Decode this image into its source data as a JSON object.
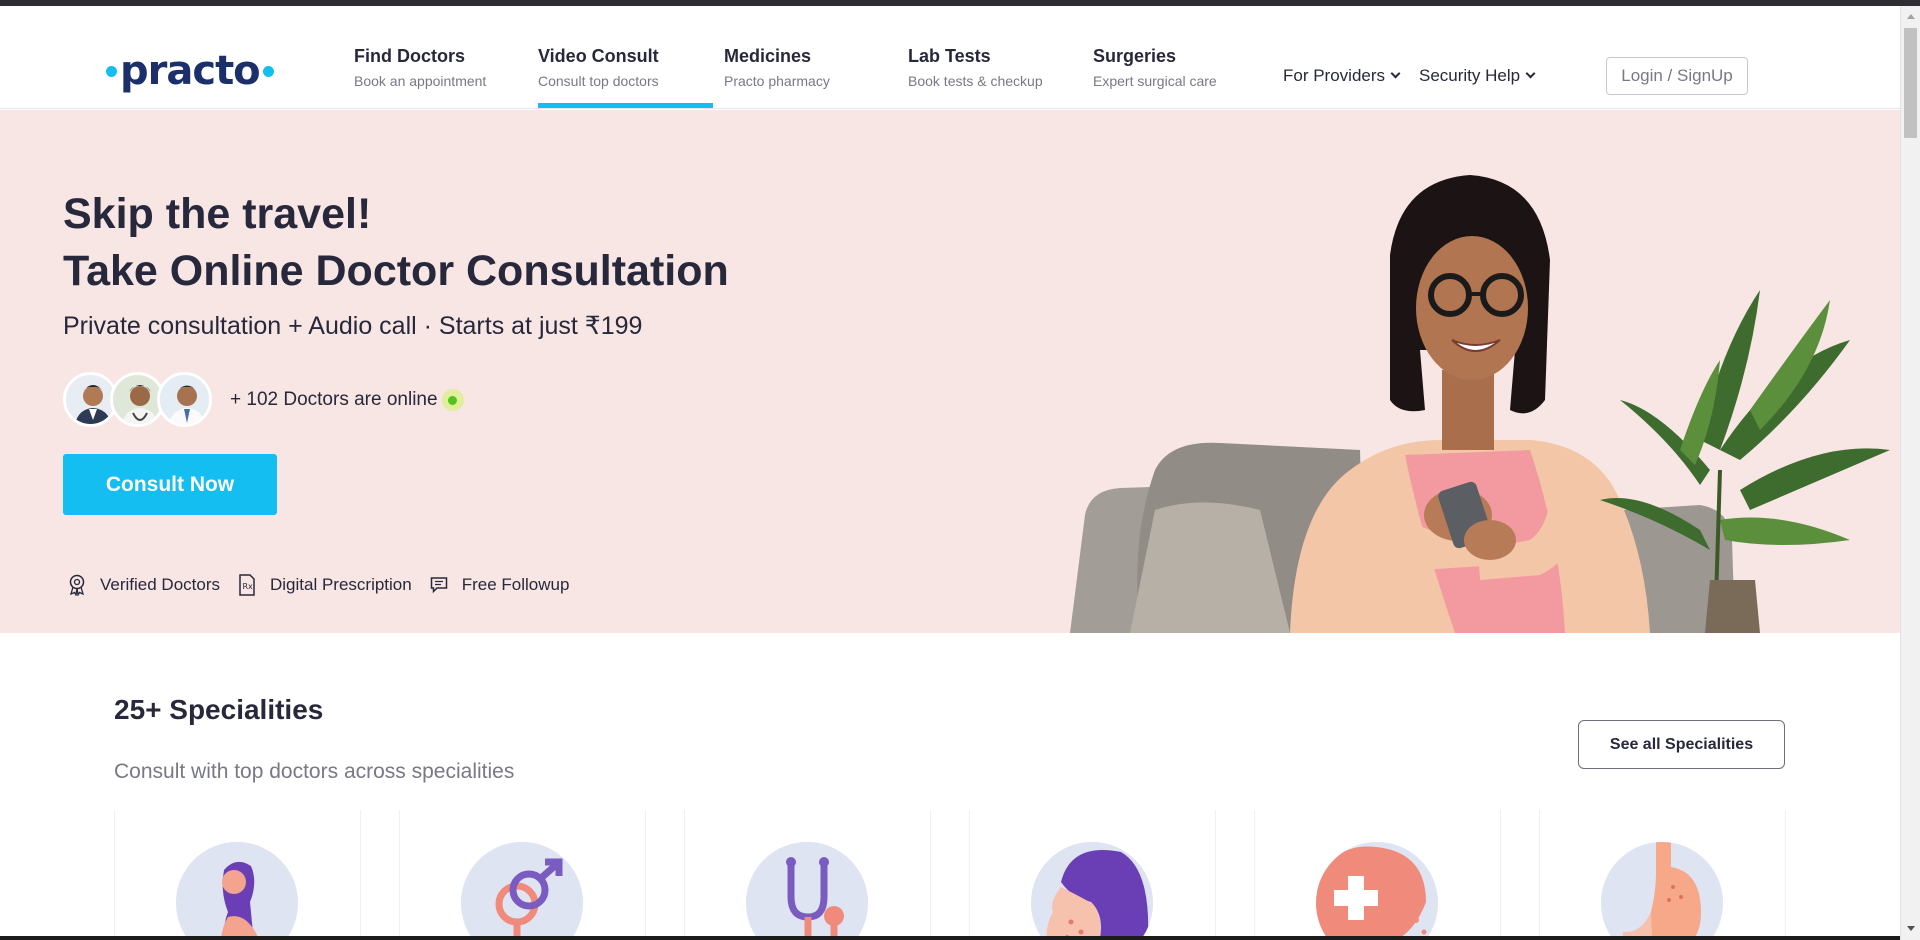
{
  "brand": {
    "logo_text": "practo",
    "accent_color": "#14bef0",
    "logo_color": "#1b2f6b"
  },
  "nav": {
    "items": [
      {
        "title": "Find Doctors",
        "subtitle": "Book an appointment"
      },
      {
        "title": "Video Consult",
        "subtitle": "Consult top doctors",
        "active": true
      },
      {
        "title": "Medicines",
        "subtitle": "Practo pharmacy"
      },
      {
        "title": "Lab Tests",
        "subtitle": "Book tests & checkup"
      },
      {
        "title": "Surgeries",
        "subtitle": "Expert surgical care"
      }
    ],
    "dropdowns": [
      "For Providers",
      "Security Help"
    ],
    "login_label": "Login / SignUp"
  },
  "hero": {
    "title_line1": "Skip the travel!",
    "title_line2": "Take Online Doctor Consultation",
    "subtitle": "Private consultation + Audio call · Starts at just ₹199",
    "online_text": "+ 102 Doctors are online",
    "cta_label": "Consult Now",
    "features": [
      "Verified Doctors",
      "Digital Prescription",
      "Free Followup"
    ],
    "background_color": "#f7e6e3"
  },
  "specialities": {
    "title": "25+ Specialities",
    "subtitle": "Consult with top doctors across specialities",
    "see_all_label": "See all Specialities"
  }
}
